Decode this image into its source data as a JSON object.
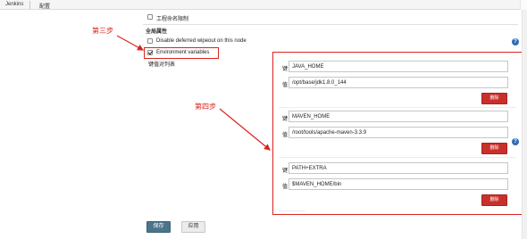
{
  "breadcrumb": {
    "home": "Jenkins",
    "current": "配置"
  },
  "options": {
    "workspace_limit_label": "工程命名限制",
    "global_props_header": "全局属性",
    "disable_wipeout_label": "Disable deferred wipeout on this node",
    "env_vars_label": "Environment variables",
    "kv_list_label": "键值对列表"
  },
  "env_vars": [
    {
      "key_label": "键",
      "value_label": "值",
      "key": "JAVA_HOME",
      "value": "/opt/base/jdk1.8.0_144",
      "delete_label": "删除"
    },
    {
      "key_label": "键",
      "value_label": "值",
      "key": "MAVEN_HOME",
      "value": "/root/tools/apache-maven-3.3.9",
      "delete_label": "删除"
    },
    {
      "key_label": "键",
      "value_label": "值",
      "key": "PATH+EXTRA",
      "value": "$MAVEN_HOME/bin",
      "delete_label": "删除"
    }
  ],
  "annotations": {
    "step3": "第三步",
    "step4": "第四步",
    "color": "#d9241c"
  },
  "buttons": {
    "save": "保存",
    "apply": "应用"
  },
  "icons": {
    "help": "question-circle-icon",
    "checkbox": "checkbox-icon"
  },
  "colors": {
    "delete_button": "#c9302c",
    "save_button": "#4b758b",
    "help_icon": "#2f6db5"
  }
}
